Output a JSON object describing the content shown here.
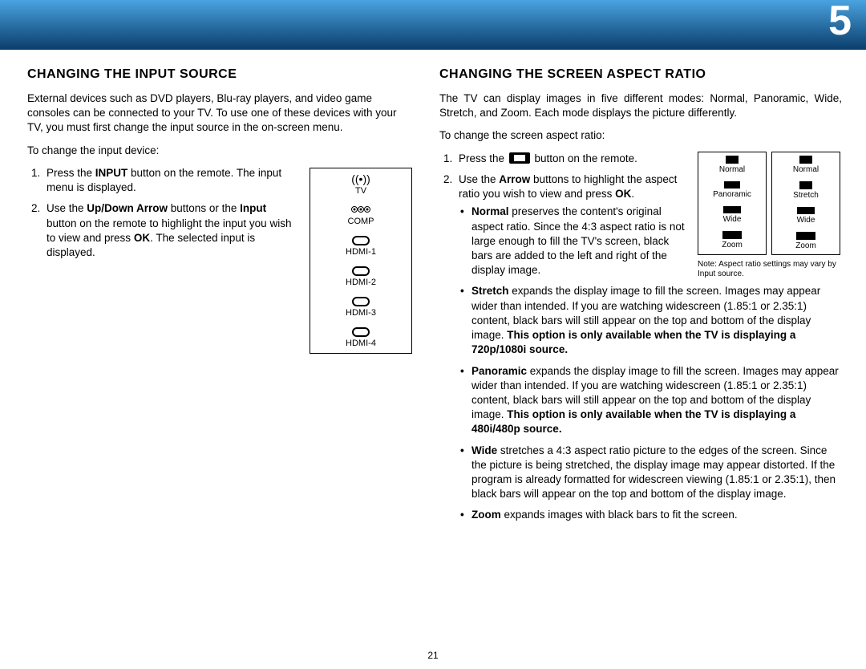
{
  "chapter": "5",
  "pageNumber": "21",
  "left": {
    "heading": "CHANGING THE INPUT SOURCE",
    "intro": "External devices such as DVD players, Blu-ray players, and video game consoles can be connected to your TV.  To use one of these devices with your TV, you must first change the input source in the on-screen menu.",
    "lead": "To change the input device:",
    "step1_pre": "Press the ",
    "step1_bold": "INPUT",
    "step1_post": " button on the remote. The input menu is displayed.",
    "step2_pre": "Use the ",
    "step2_bold1": "Up/Down Arrow",
    "step2_mid": " buttons or the ",
    "step2_bold2": "Input",
    "step2_mid2": " button on the remote to highlight the input you wish to view and press ",
    "step2_bold3": "OK",
    "step2_post": ". The selected input is displayed.",
    "menu": [
      "TV",
      "COMP",
      "HDMI-1",
      "HDMI-2",
      "HDMI-3",
      "HDMI-4"
    ]
  },
  "right": {
    "heading": "CHANGING THE SCREEN ASPECT RATIO",
    "intro": "The TV can display images in five different modes: Normal, Panoramic, Wide, Stretch, and Zoom. Each mode displays the picture differently.",
    "lead": "To change the screen aspect ratio:",
    "step1_pre": "Press the ",
    "step1_post": " button on the remote.",
    "step2_pre": "Use the ",
    "step2_bold": "Arrow",
    "step2_mid": " buttons to highlight the aspect ratio you wish to view and press ",
    "step2_bold2": "OK",
    "step2_post": ".",
    "bullets": {
      "normal_b": "Normal",
      "normal_t": " preserves the content's original aspect ratio. Since the 4:3 aspect ratio is not large enough to fill the TV's screen, black bars are added to the left and right of the display image.",
      "stretch_b": "Stretch",
      "stretch_t": " expands the display image to fill the screen. Images may appear wider than intended. If you are watching widescreen (1.85:1 or 2.35:1) content, black bars will still appear on the top and bottom of the display image. ",
      "stretch_bold2": "This option is only available when the TV is displaying a 720p/1080i source.",
      "pano_b": "Panoramic",
      "pano_t": " expands the display image to fill the screen. Images may appear wider than intended. If you are watching widescreen (1.85:1 or 2.35:1) content, black bars will still appear on the top and bottom of the display image. ",
      "pano_bold2": "This option is only available when the TV is displaying a 480i/480p source.",
      "wide_b": "Wide",
      "wide_t": " stretches a 4:3 aspect ratio picture to the edges of the screen. Since the picture is being stretched, the display image may appear distorted. If the program is already formatted for widescreen viewing (1.85:1 or 2.35:1), then black bars will appear on the top and bottom of the display image.",
      "zoom_b": "Zoom",
      "zoom_t": " expands images with black bars to fit the screen."
    },
    "aspectCol1": [
      "Normal",
      "Panoramic",
      "Wide",
      "Zoom"
    ],
    "aspectCol2": [
      "Normal",
      "Stretch",
      "Wide",
      "Zoom"
    ],
    "aspectNote": "Note: Aspect ratio settings may vary by Input source."
  }
}
